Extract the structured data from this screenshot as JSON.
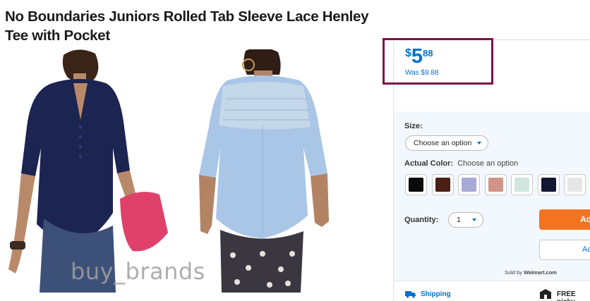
{
  "product": {
    "title": "No Boundaries Juniors Rolled Tab Sleeve Lace Henley Tee with Pocket",
    "watermark": "buy_brands"
  },
  "price": {
    "currency": "$",
    "dollars": "5",
    "cents": "88",
    "was": "Was $9.88",
    "highlight_color": "#7b1346",
    "accent_color": "#0071ce"
  },
  "options": {
    "size_label": "Size:",
    "size_value": "Choose an option",
    "color_label": "Actual Color:",
    "color_hint": "Choose an option",
    "swatches": [
      {
        "name": "black",
        "color": "#0b0b0b"
      },
      {
        "name": "brown",
        "color": "#4a1f14"
      },
      {
        "name": "lavender",
        "color": "#a9a9d6"
      },
      {
        "name": "rose",
        "color": "#d29488"
      },
      {
        "name": "mint",
        "color": "#cfe6de"
      },
      {
        "name": "navy",
        "color": "#141834"
      },
      {
        "name": "light-gray",
        "color": "#e6e6e6"
      }
    ],
    "qty_label": "Quantity:",
    "qty_value": "1"
  },
  "actions": {
    "add_label": "Ad",
    "registry_label": "Ac",
    "add_color": "#f47321",
    "sold_by_prefix": "Sold by",
    "sold_by_name": "Walmart.com"
  },
  "fulfillment": {
    "shipping_label": "Shipping",
    "pickup_label": "FREE picku",
    "shipping_icon": "truck-icon",
    "pickup_icon": "store-icon"
  }
}
